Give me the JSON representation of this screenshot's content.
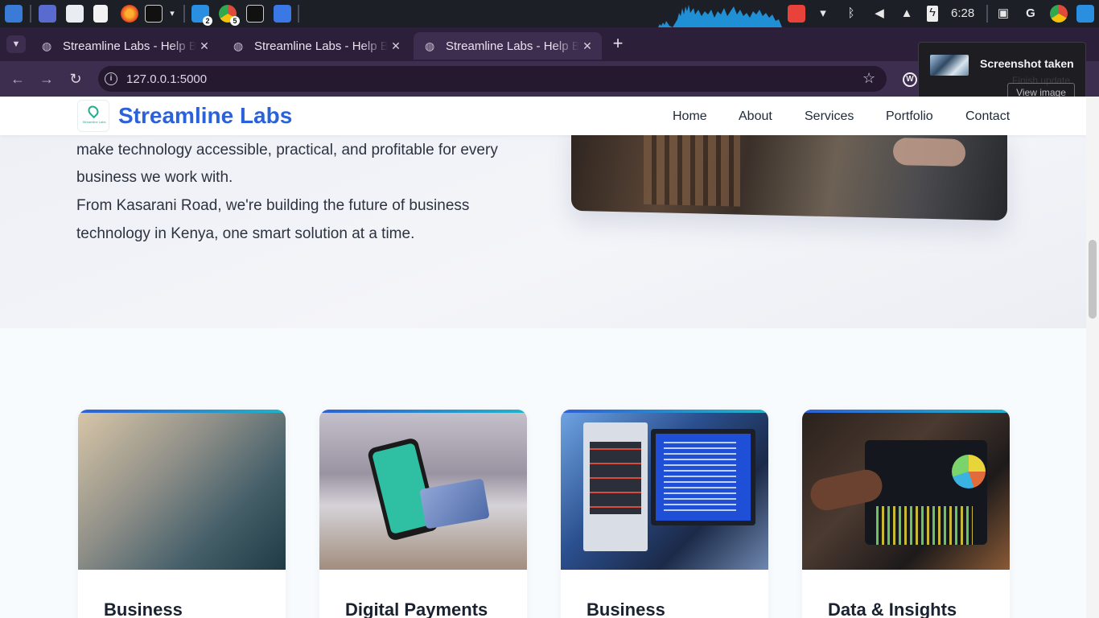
{
  "taskbar": {
    "clock": "6:28",
    "badges": {
      "vscode": "2",
      "chrome": "5"
    }
  },
  "browser": {
    "tabs": [
      {
        "title": "Streamline Labs - Help Business",
        "active": false
      },
      {
        "title": "Streamline Labs - Help Business",
        "active": false
      },
      {
        "title": "Streamline Labs - Help Business",
        "active": true
      }
    ],
    "url": "127.0.0.1:5000",
    "ext_label": "W"
  },
  "notification": {
    "title": "Screenshot taken",
    "action": "View image",
    "ghost_text": "Finish update"
  },
  "site": {
    "brand": "Streamline Labs",
    "logo_text": "Streamline Labs",
    "nav": [
      "Home",
      "About",
      "Services",
      "Portfolio",
      "Contact"
    ],
    "hero": {
      "line1": "make technology accessible, practical, and profitable for every",
      "line2": "business we work with.",
      "line3": "From Kasarani Road, we're building the future of business",
      "line4": "technology in Kenya, one smart solution at a time."
    },
    "services": [
      {
        "title": "Business",
        "image": "digital-marketing-laptop-image"
      },
      {
        "title": "Digital Payments",
        "image": "mobile-payment-card-image"
      },
      {
        "title": "Business",
        "image": "server-computer-image"
      },
      {
        "title": "Data & Insights",
        "image": "analytics-dashboard-image"
      }
    ]
  },
  "colors": {
    "brand": "#2b62d9",
    "accent_gradient_start": "#2f5fd6",
    "accent_gradient_end": "#20b4c9",
    "browser_frame": "#3d2d4f"
  }
}
